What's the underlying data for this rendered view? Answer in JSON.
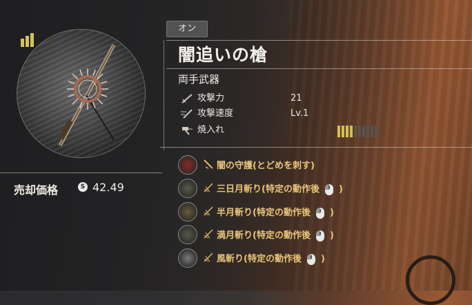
{
  "equip_state": "オン",
  "weapon": {
    "name": "闇追いの槍",
    "type": "両手武器",
    "upgrade_level_bars": 3
  },
  "stats": [
    {
      "icon": "sword-icon",
      "label": "攻撃力",
      "value": "21"
    },
    {
      "icon": "speed-sword-icon",
      "label": "攻撃速度",
      "value": "Lv.1"
    },
    {
      "icon": "forge-hammer-icon",
      "label": "焼入れ",
      "value": ""
    }
  ],
  "tempering": {
    "filled": 4,
    "total": 10
  },
  "skills": [
    {
      "text": "闇の守護(とどめを刺す)",
      "suffix": "",
      "mouse": false,
      "icon": "dark-guard-icon",
      "color": "#8a2b22"
    },
    {
      "text": "三日月斬り(特定の動作後",
      "suffix": ")",
      "mouse": true,
      "icon": "crescent-slash-icon",
      "color": "#5a5a4a"
    },
    {
      "text": "半月斬り(特定の動作後",
      "suffix": ")",
      "mouse": true,
      "icon": "half-moon-slash-icon",
      "color": "#6a5a3a"
    },
    {
      "text": "満月斬り(特定の動作後",
      "suffix": ")",
      "mouse": true,
      "icon": "full-moon-slash-icon",
      "color": "#5a5a4a"
    },
    {
      "text": "風斬り(特定の動作後",
      "suffix": ")",
      "mouse": true,
      "icon": "wind-slash-icon",
      "color": "#7a7a7a"
    }
  ],
  "sell": {
    "label": "売却価格",
    "coin_symbol": "S",
    "value": "42.49"
  },
  "colors": {
    "skill_text": "#e9c57a",
    "gauge_on": "#d2bf55",
    "gauge_off": "#58524a"
  }
}
